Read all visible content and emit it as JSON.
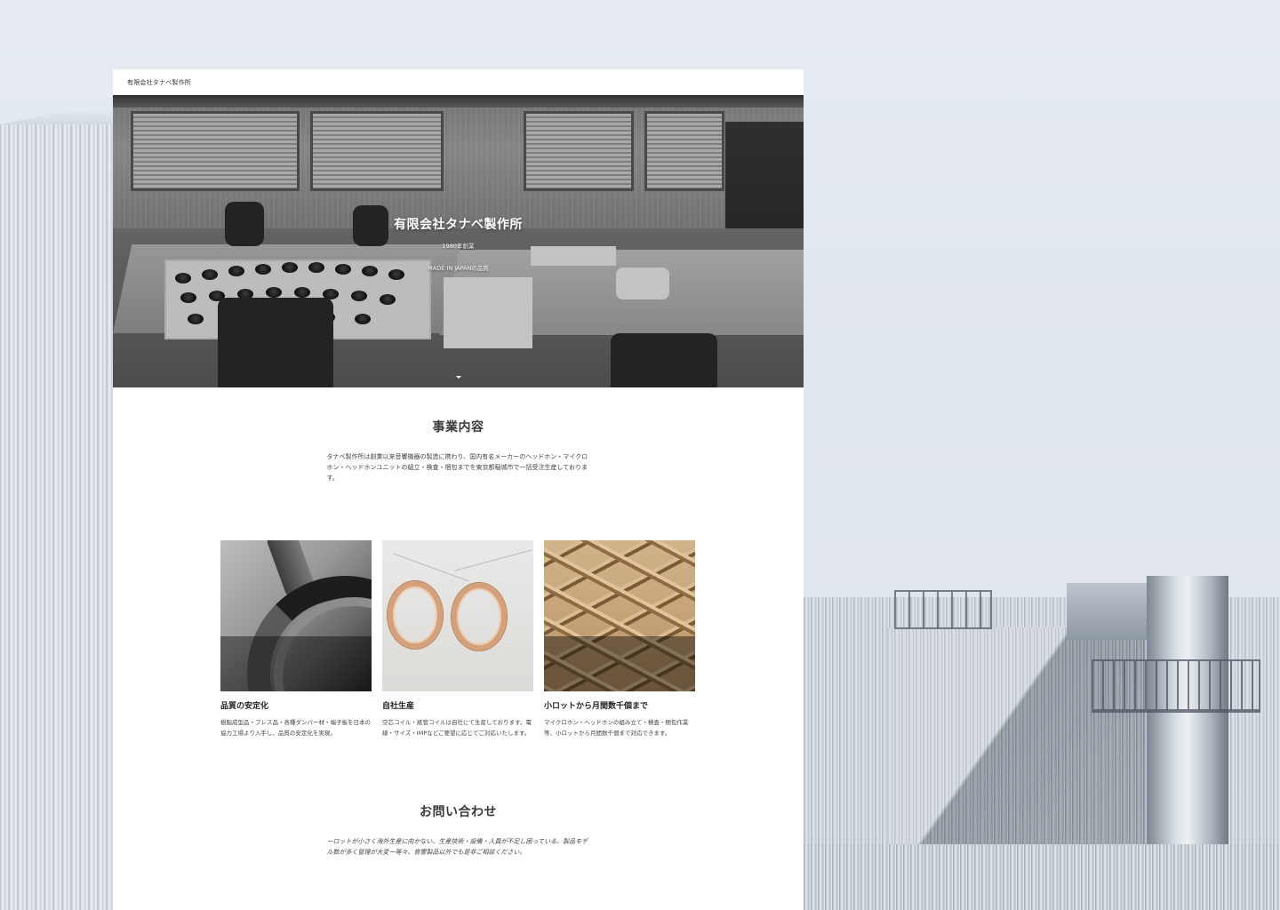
{
  "site": {
    "logo": "有限会社タナベ製作所"
  },
  "hero": {
    "title": "有限会社タナベ製作所",
    "subtitle": "1980年創業",
    "tagline": "MADE IN JAPANの品質"
  },
  "business": {
    "title": "事業内容",
    "description": "タナベ製作所は創業以来音響機器の製造に携わり、国内有名メーカーのヘッドホン・マイクロホン・ヘッドホンユニットの組立・検査・梱包までを東京都稲城市で一括受注生産しております。"
  },
  "features": [
    {
      "title": "品質の安定化",
      "description": "樹脂成型品・プレス品・各種ダンパー材・端子板を日本の協力工場より入手し、品質の安定化を実現。"
    },
    {
      "title": "自社生産",
      "description": "空芯コイル・紙管コイルは自社にて生産しております。電線・サイズ・IMPなどご要望に応じてご対応いたします。"
    },
    {
      "title": "小ロットから月間数千個まで",
      "description": "マイクロホン・ヘッドホンの組み立て・検査・梱包作業等、小ロットから月間数千個まで対応できます。"
    }
  ],
  "contact": {
    "title": "お問い合わせ",
    "description": "ーロットが小さく海外生産に向かない、生産技術・設備・人員が不足し困っている。製品モデル数が多く管理が大変ー等々、音響製品以外でも是非ご相談ください。"
  }
}
